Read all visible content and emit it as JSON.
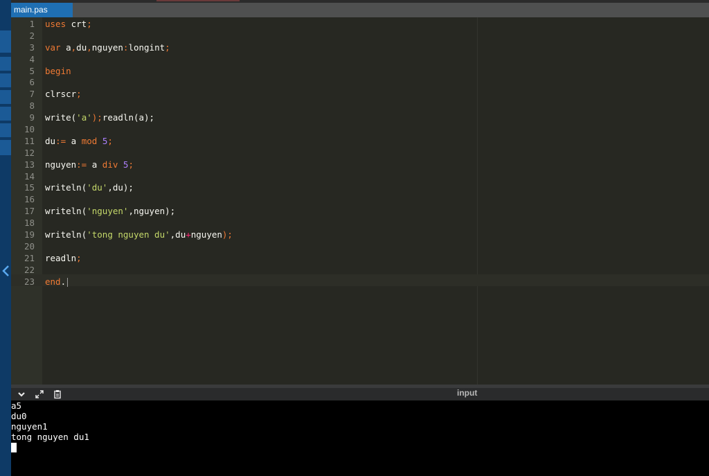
{
  "tabs": [
    {
      "label": "main.pas",
      "active": true
    }
  ],
  "code_lines": [
    [
      {
        "t": "uses",
        "c": "kw"
      },
      {
        "t": " crt",
        "c": "id"
      },
      {
        "t": ";",
        "c": "kw"
      }
    ],
    [],
    [
      {
        "t": "var",
        "c": "kw"
      },
      {
        "t": " a",
        "c": "id"
      },
      {
        "t": ",",
        "c": "kw"
      },
      {
        "t": "du",
        "c": "id"
      },
      {
        "t": ",",
        "c": "kw"
      },
      {
        "t": "nguyen",
        "c": "id"
      },
      {
        "t": ":",
        "c": "kw"
      },
      {
        "t": "longint",
        "c": "id"
      },
      {
        "t": ";",
        "c": "kw"
      }
    ],
    [],
    [
      {
        "t": "begin",
        "c": "kw"
      }
    ],
    [],
    [
      {
        "t": "clrscr",
        "c": "id"
      },
      {
        "t": ";",
        "c": "kw"
      }
    ],
    [],
    [
      {
        "t": "write",
        "c": "id"
      },
      {
        "t": "(",
        "c": "id"
      },
      {
        "t": "'a'",
        "c": "str"
      },
      {
        "t": ");",
        "c": "kw"
      },
      {
        "t": "readln",
        "c": "id"
      },
      {
        "t": "(a);",
        "c": "id"
      }
    ],
    [],
    [
      {
        "t": "du",
        "c": "id"
      },
      {
        "t": ":=",
        "c": "kw"
      },
      {
        "t": " a ",
        "c": "id"
      },
      {
        "t": "mod",
        "c": "kw"
      },
      {
        "t": " ",
        "c": "id"
      },
      {
        "t": "5",
        "c": "num"
      },
      {
        "t": ";",
        "c": "kw"
      }
    ],
    [],
    [
      {
        "t": "nguyen",
        "c": "id"
      },
      {
        "t": ":=",
        "c": "kw"
      },
      {
        "t": " a ",
        "c": "id"
      },
      {
        "t": "div",
        "c": "kw"
      },
      {
        "t": " ",
        "c": "id"
      },
      {
        "t": "5",
        "c": "num"
      },
      {
        "t": ";",
        "c": "kw"
      }
    ],
    [],
    [
      {
        "t": "writeln",
        "c": "id"
      },
      {
        "t": "(",
        "c": "id"
      },
      {
        "t": "'du'",
        "c": "str"
      },
      {
        "t": ",du);",
        "c": "id"
      }
    ],
    [],
    [
      {
        "t": "writeln",
        "c": "id"
      },
      {
        "t": "(",
        "c": "id"
      },
      {
        "t": "'nguyen'",
        "c": "str"
      },
      {
        "t": ",nguyen);",
        "c": "id"
      }
    ],
    [],
    [
      {
        "t": "writeln",
        "c": "id"
      },
      {
        "t": "(",
        "c": "id"
      },
      {
        "t": "'tong nguyen du'",
        "c": "str"
      },
      {
        "t": ",du",
        "c": "id"
      },
      {
        "t": "+",
        "c": "op"
      },
      {
        "t": "nguyen",
        "c": "id"
      },
      {
        "t": ");",
        "c": "kw"
      }
    ],
    [],
    [
      {
        "t": "readln",
        "c": "id"
      },
      {
        "t": ";",
        "c": "kw"
      }
    ],
    [],
    [
      {
        "t": "end",
        "c": "kw"
      },
      {
        "t": ".",
        "c": "id"
      }
    ]
  ],
  "console": {
    "toolbar": {
      "collapse_icon": "chevron-down-icon",
      "expand_icon": "expand-icon",
      "clear_icon": "clipboard-icon",
      "input_label": "input"
    },
    "output_lines": [
      "a5",
      "du0",
      "nguyen1",
      "tong nguyen du1"
    ]
  },
  "colors": {
    "keyword": "#f07a34",
    "string": "#c5d96a",
    "number": "#ae81ff",
    "operator": "#f92672",
    "tab_active": "#1f6fb3"
  }
}
